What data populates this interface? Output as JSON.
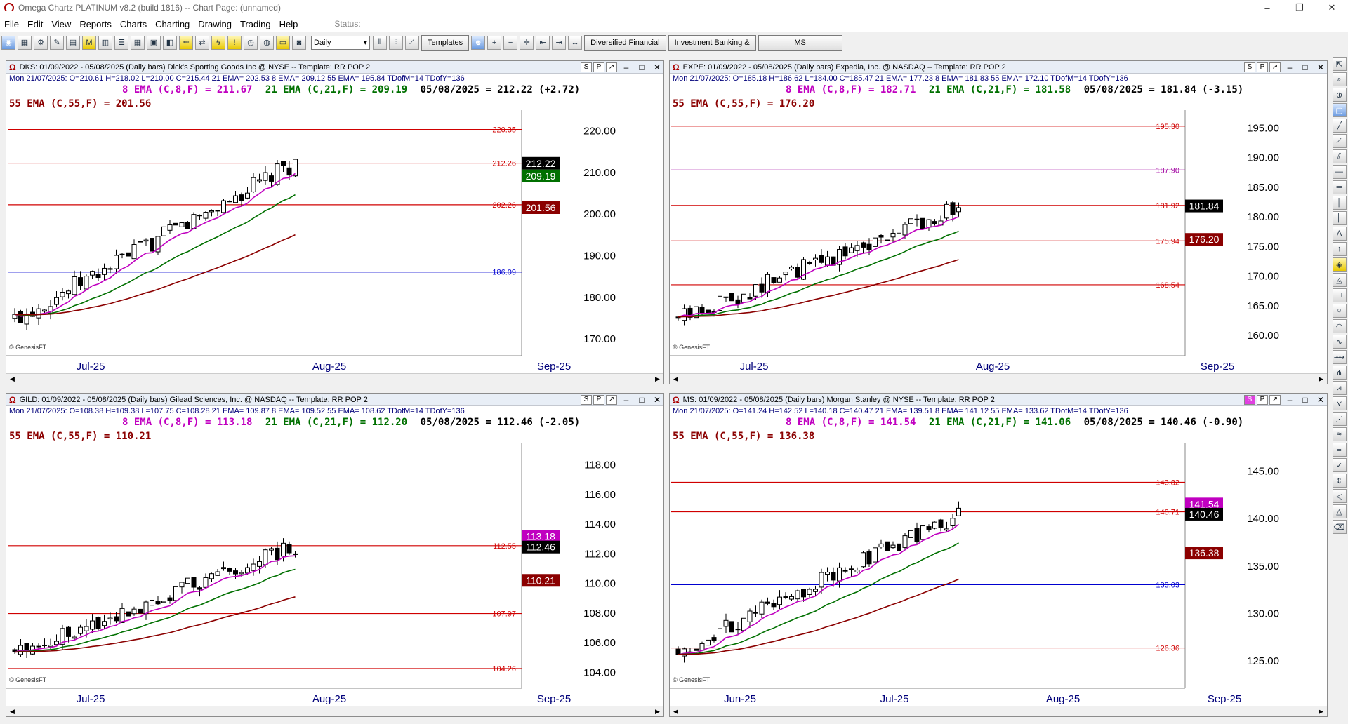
{
  "app": {
    "title": "Omega Chartz PLATINUM v8.2 (build 1816)  --  Chart Page: (unnamed)",
    "window_buttons": [
      "–",
      "❐",
      "✕"
    ]
  },
  "menu": {
    "items": [
      "File",
      "Edit",
      "View",
      "Reports",
      "Charts",
      "Charting",
      "Drawing",
      "Trading",
      "Help"
    ],
    "status_label": "Status:"
  },
  "toolbar": {
    "interval_select": "Daily",
    "templates_button": "Templates",
    "pages": [
      "Diversified Financial",
      "Investment Banking &",
      "MS"
    ]
  },
  "colors": {
    "ema8": "#c000c0",
    "ema21": "#007000",
    "ema55": "#8b0000",
    "level_red": "#d00000",
    "level_blue": "#0000d0",
    "level_purple": "#a000a0"
  },
  "watermark_text": "© GenesisFT",
  "charts": [
    {
      "id": "dks",
      "title": "DKS: 01/09/2022 - 05/08/2025  (Daily bars)  Dick's Sporting Goods Inc @ NYSE  --  Template: RR POP 2",
      "ohlc": "Mon   21/07/2025:  O=210.61   H=218.02   L=210.00   C=215.44   21 EMA= 202.53   8 EMA= 209.12   55 EMA= 195.84   TDofM=14   TDofY=136",
      "ema8_label": "8 EMA (C,8,F) = 211.67",
      "ema21_label": "21 EMA (C,21,F) = 209.19",
      "close_label": "05/08/2025 = 212.22 (+2.72)",
      "ema55_label": "55 EMA (C,55,F) = 201.56",
      "x_labels": [
        "Jul-25",
        "Aug-25",
        "Sep-25"
      ],
      "y_ticks": [
        "220.00",
        "210.00",
        "200.00",
        "190.00",
        "180.00",
        "170.00"
      ],
      "levels": [
        "220.35",
        "212.26",
        "202.26",
        "186.09"
      ],
      "tags": {
        "close": "212.22",
        "ema21": "209.19",
        "ema55": "201.56"
      },
      "ymin": 168,
      "ymax": 225
    },
    {
      "id": "expe",
      "title": "EXPE: 01/09/2022 - 05/08/2025  (Daily bars)  Expedia, Inc. @ NASDAQ  --  Template: RR POP 2",
      "ohlc": "Mon   21/07/2025:  O=185.18   H=186.62   L=184.00   C=185.47   21 EMA= 177.23   8 EMA= 181.83   55 EMA= 172.10   TDofM=14   TDofY=136",
      "ema8_label": "8 EMA (C,8,F) = 182.71",
      "ema21_label": "21 EMA (C,21,F) = 181.58",
      "close_label": "05/08/2025 = 181.84 (-3.15)",
      "ema55_label": "55 EMA (C,55,F) = 176.20",
      "x_labels": [
        "Jul-25",
        "Aug-25",
        "Sep-25"
      ],
      "y_ticks": [
        "195.00",
        "190.00",
        "185.00",
        "180.00",
        "175.00",
        "170.00",
        "165.00",
        "160.00"
      ],
      "levels": [
        "195.30",
        "187.90",
        "181.92",
        "175.94",
        "168.54"
      ],
      "tags": {
        "close": "181.84",
        "ema55": "176.20"
      },
      "ymin": 158,
      "ymax": 198
    },
    {
      "id": "gild",
      "title": "GILD: 01/09/2022 - 05/08/2025  (Daily bars)  Gilead Sciences, Inc. @ NASDAQ  --  Template: RR POP 2",
      "ohlc": "Mon   21/07/2025:  O=108.38   H=109.38   L=107.75   C=108.28   21 EMA= 109.87   8 EMA= 109.52   55 EMA= 108.62   TDofM=14   TDofY=136",
      "ema8_label": "8 EMA (C,8,F) = 113.18",
      "ema21_label": "21 EMA (C,21,F) = 112.20",
      "close_label": "05/08/2025 = 112.46 (-2.05)",
      "ema55_label": "55 EMA (C,55,F) = 110.21",
      "x_labels": [
        "Jul-25",
        "Aug-25",
        "Sep-25"
      ],
      "y_ticks": [
        "118.00",
        "116.00",
        "114.00",
        "112.00",
        "110.00",
        "108.00",
        "106.00",
        "104.00"
      ],
      "levels": [
        "112.55",
        "107.97",
        "104.26"
      ],
      "tags": {
        "ema8": "113.18",
        "close": "112.46",
        "ema55": "110.21"
      },
      "ymin": 103.5,
      "ymax": 119.5
    },
    {
      "id": "ms",
      "title": "MS: 01/09/2022 - 05/08/2025  (Daily bars)  Morgan Stanley @ NYSE  --  Template: RR POP 2",
      "ohlc": "Mon   21/07/2025:  O=141.24   H=142.52   L=140.18   C=140.47   21 EMA= 139.51   8 EMA= 141.12   55 EMA= 133.62   TDofM=14   TDofY=136",
      "ema8_label": "8 EMA (C,8,F) = 141.54",
      "ema21_label": "21 EMA (C,21,F) = 141.06",
      "close_label": "05/08/2025 = 140.46 (-0.90)",
      "ema55_label": "55 EMA (C,55,F) = 136.38",
      "x_labels": [
        "Jun-25",
        "Jul-25",
        "Aug-25",
        "Sep-25"
      ],
      "y_ticks": [
        "145.00",
        "140.00",
        "135.00",
        "130.00",
        "125.00"
      ],
      "levels": [
        "143.82",
        "140.71",
        "133.03",
        "126.36"
      ],
      "tags": {
        "ema8": "141.54",
        "close": "140.46",
        "ema55": "136.38"
      },
      "ymin": 123,
      "ymax": 148
    }
  ]
}
